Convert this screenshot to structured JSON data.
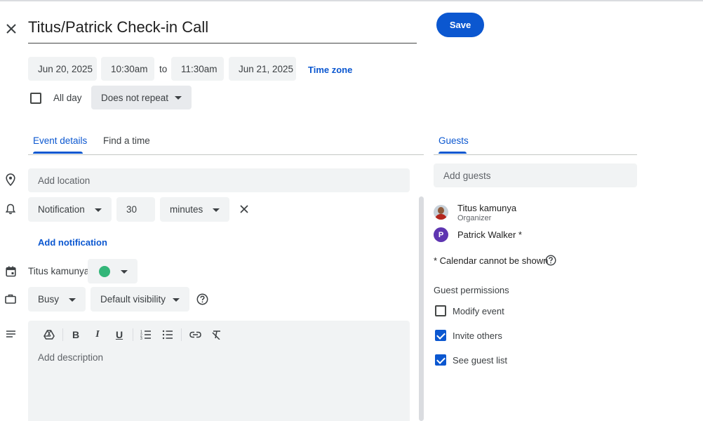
{
  "event": {
    "title": "Titus/Patrick Check-in Call"
  },
  "header": {
    "save_label": "Save",
    "close_icon": "close-icon"
  },
  "datetime": {
    "start_date": "Jun 20, 2025",
    "start_time": "10:30am",
    "to_label": "to",
    "end_time": "11:30am",
    "end_date": "Jun 21, 2025",
    "timezone_label": "Time zone"
  },
  "options": {
    "all_day_label": "All day",
    "all_day_checked": false,
    "repeat_value": "Does not repeat"
  },
  "tabs": [
    {
      "label": "Event details",
      "active": true
    },
    {
      "label": "Find a time",
      "active": false
    }
  ],
  "details": {
    "location_placeholder": "Add location",
    "notification": {
      "type": "Notification",
      "amount": "30",
      "unit": "minutes"
    },
    "add_notification_label": "Add notification",
    "calendar_owner": "Titus kamunya",
    "calendar_color": "#33b679",
    "busy_value": "Busy",
    "visibility_value": "Default visibility",
    "description_placeholder": "Add description"
  },
  "guests": {
    "tab_label": "Guests",
    "add_placeholder": "Add guests",
    "list": [
      {
        "name": "Titus kamunya",
        "role": "Organizer"
      },
      {
        "name": "Patrick Walker *",
        "initial": "P",
        "avatar_color": "#5e35b1"
      }
    ],
    "calendar_note": "* Calendar cannot be shown",
    "permissions_title": "Guest permissions",
    "permissions": [
      {
        "label": "Modify event",
        "checked": false
      },
      {
        "label": "Invite others",
        "checked": true
      },
      {
        "label": "See guest list",
        "checked": true
      }
    ]
  },
  "colors": {
    "accent": "#0b57d0",
    "field_bg": "#f1f3f4"
  }
}
